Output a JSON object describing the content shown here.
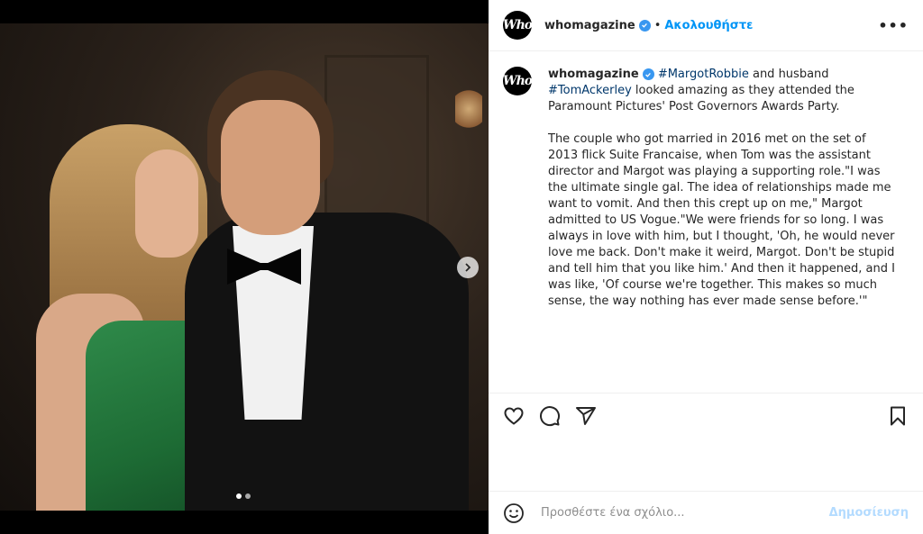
{
  "account": {
    "avatar_text": "Who",
    "username": "whomagazine",
    "separator": "•",
    "follow_label": "Ακολουθήστε",
    "more_label": "•••"
  },
  "caption": {
    "username": "whomagazine",
    "tag1": "#MargotRobbie",
    "text1": " and husband ",
    "tag2": "#TomAckerley",
    "text2": " looked amazing as they attended the Paramount Pictures' Post Governors Awards Party.",
    "paragraph2": "The couple who got married in 2016 met on the set of 2013 flick Suite Francaise, when Tom was the assistant director and Margot was playing a supporting role.\"I was the ultimate single gal. The idea of relationships made me want to vomit. And then this crept up on me,\" Margot admitted to US Vogue.\"We were friends for so long. I was always in love with him, but I thought, 'Oh, he would never love me back. Don't make it weird, Margot. Don't be stupid and tell him that you like him.' And then it happened, and I was like, 'Of course we're together. This makes so much sense, the way nothing has ever made sense before.'\""
  },
  "actions": {
    "like": "heart-icon",
    "comment": "comment-icon",
    "share": "send-icon",
    "save": "bookmark-icon"
  },
  "comment_box": {
    "placeholder": "Προσθέστε ένα σχόλιο...",
    "post_label": "Δημοσίευση"
  },
  "carousel": {
    "total": 2,
    "current": 1
  },
  "colors": {
    "link": "#0095f6",
    "hashtag": "#00376b",
    "verified": "#3897f0",
    "post_disabled": "#b3dbff"
  }
}
